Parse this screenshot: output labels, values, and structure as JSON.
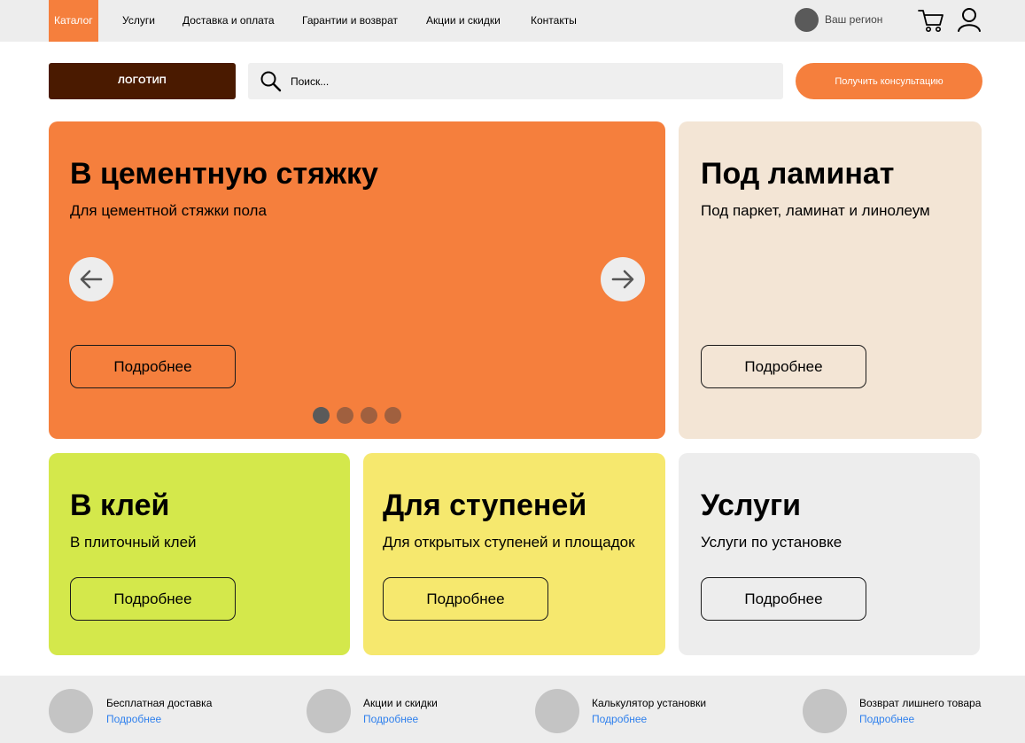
{
  "nav": {
    "items": [
      {
        "label": "Каталог",
        "active": true
      },
      {
        "label": "Услуги"
      },
      {
        "label": "Доставка и оплата"
      },
      {
        "label": "Гарантии и возврат"
      },
      {
        "label": "Акции и скидки"
      },
      {
        "label": "Контакты"
      }
    ],
    "region_label": "Ваш регион",
    "icons": [
      "cart-icon",
      "user-icon"
    ]
  },
  "header": {
    "logo_label": "ЛОГОТИП",
    "search_placeholder": "Поиск...",
    "consult_label": "Получить консультацию"
  },
  "hero": {
    "title": "В цементную стяжку",
    "subtitle": "Для цементной стяжки пола",
    "more_label": "Подробнее",
    "prev_icon": "arrow-left-icon",
    "next_icon": "arrow-right-icon",
    "slides_total": 4,
    "active_slide": 1
  },
  "cards": [
    {
      "title": "Под ламинат",
      "subtitle": "Под паркет, ламинат и линолеум",
      "more_label": "Подробнее",
      "color": "#f3e5d5"
    },
    {
      "title": "В клей",
      "subtitle": "В плиточный клей",
      "more_label": "Подробнее",
      "color": "#d4e84b"
    },
    {
      "title": "Для ступеней",
      "subtitle": "Для открытых ступеней и площадок",
      "more_label": "Подробнее",
      "color": "#f6e86e"
    },
    {
      "title": "Услуги",
      "subtitle": "Услуги по установке",
      "more_label": "Подробнее",
      "color": "#ededed"
    }
  ],
  "features": [
    {
      "title": "Бесплатная доставка",
      "link": "Подробнее"
    },
    {
      "title": "Акции и скидки",
      "link": "Подробнее"
    },
    {
      "title": "Калькулятор установки",
      "link": "Подробнее"
    },
    {
      "title": "Возврат лишнего товара",
      "link": "Подробнее"
    }
  ],
  "colors": {
    "accent": "#f57f3d",
    "logo_bg": "#4a1a00",
    "link": "#2f80ed",
    "dot_active": "#5a5a5a",
    "dot_inactive": "#a0603f"
  }
}
